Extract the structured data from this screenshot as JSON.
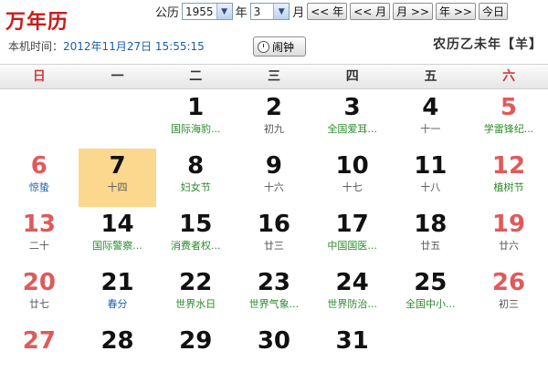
{
  "app_title": "万年历",
  "controls": {
    "label_gregorian": "公历",
    "year_value": "1955",
    "year_unit": "年",
    "month_value": "3",
    "month_unit": "月",
    "btn_prev_year": "<< 年",
    "btn_prev_month": "<< 月",
    "btn_next_month": "月 >>",
    "btn_next_year": "年 >>",
    "btn_today": "今日"
  },
  "time": {
    "label": "本机时间：",
    "value": "2012年11月27日 15:55:15"
  },
  "alarm_label": "闹钟",
  "lunar_year": "农历乙未年【羊】",
  "weekdays": [
    "日",
    "一",
    "二",
    "三",
    "四",
    "五",
    "六"
  ],
  "weeks": [
    [
      null,
      null,
      {
        "day": "1",
        "sub": "国际海豹...",
        "kind": "fest"
      },
      {
        "day": "2",
        "sub": "初九",
        "kind": "plain"
      },
      {
        "day": "3",
        "sub": "全国爱耳...",
        "kind": "fest"
      },
      {
        "day": "4",
        "sub": "十一",
        "kind": "plain"
      },
      {
        "day": "5",
        "sub": "学雷锋纪...",
        "kind": "fest"
      }
    ],
    [
      {
        "day": "6",
        "sub": "惊蛰",
        "kind": "blue"
      },
      {
        "day": "7",
        "sub": "十四",
        "kind": "plain",
        "today": true
      },
      {
        "day": "8",
        "sub": "妇女节",
        "kind": "fest"
      },
      {
        "day": "9",
        "sub": "十六",
        "kind": "plain"
      },
      {
        "day": "10",
        "sub": "十七",
        "kind": "plain"
      },
      {
        "day": "11",
        "sub": "十八",
        "kind": "plain"
      },
      {
        "day": "12",
        "sub": "植树节",
        "kind": "fest"
      }
    ],
    [
      {
        "day": "13",
        "sub": "二十",
        "kind": "plain"
      },
      {
        "day": "14",
        "sub": "国际警察...",
        "kind": "fest"
      },
      {
        "day": "15",
        "sub": "消费者权...",
        "kind": "fest"
      },
      {
        "day": "16",
        "sub": "廿三",
        "kind": "plain"
      },
      {
        "day": "17",
        "sub": "中国国医...",
        "kind": "fest"
      },
      {
        "day": "18",
        "sub": "廿五",
        "kind": "plain"
      },
      {
        "day": "19",
        "sub": "廿六",
        "kind": "plain"
      }
    ],
    [
      {
        "day": "20",
        "sub": "廿七",
        "kind": "plain"
      },
      {
        "day": "21",
        "sub": "春分",
        "kind": "blue"
      },
      {
        "day": "22",
        "sub": "世界水日",
        "kind": "fest"
      },
      {
        "day": "23",
        "sub": "世界气象...",
        "kind": "fest"
      },
      {
        "day": "24",
        "sub": "世界防治...",
        "kind": "fest"
      },
      {
        "day": "25",
        "sub": "全国中小...",
        "kind": "fest"
      },
      {
        "day": "26",
        "sub": "初三",
        "kind": "plain"
      }
    ],
    [
      {
        "day": "27",
        "sub": "",
        "kind": "plain"
      },
      {
        "day": "28",
        "sub": "",
        "kind": "plain"
      },
      {
        "day": "29",
        "sub": "",
        "kind": "plain"
      },
      {
        "day": "30",
        "sub": "",
        "kind": "plain"
      },
      {
        "day": "31",
        "sub": "",
        "kind": "plain"
      },
      null,
      null
    ]
  ],
  "colors": {
    "title": "#cc1a1a",
    "weekend": "#e05a5a",
    "festival": "#2a8a2a",
    "solar_term": "#1f5fb0",
    "today_bg": "#fbd88e"
  }
}
